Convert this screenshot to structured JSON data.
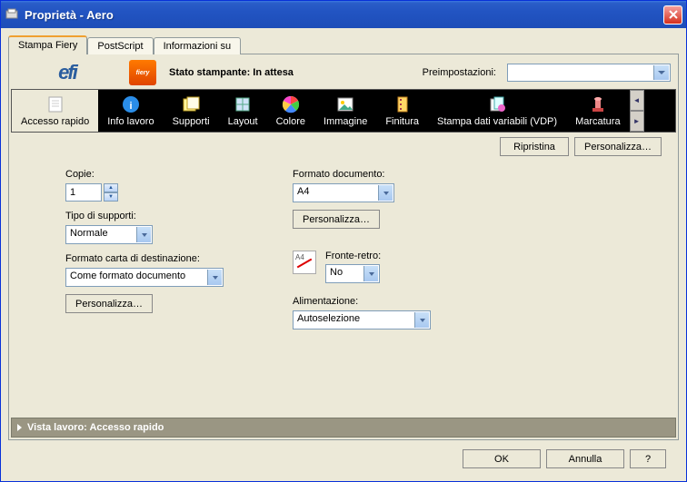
{
  "title": "Proprietà - Aero",
  "tabs": {
    "t0": "Stampa Fiery",
    "t1": "PostScript",
    "t2": "Informazioni su"
  },
  "header": {
    "status_prefix": "Stato stampante: ",
    "status_value": "In attesa",
    "presets_label": "Preimpostazioni:"
  },
  "toolbar": {
    "access": "Accesso rapido",
    "info": "Info lavoro",
    "media": "Supporti",
    "layout": "Layout",
    "color": "Colore",
    "image": "Immagine",
    "finish": "Finitura",
    "vdp": "Stampa dati variabili (VDP)",
    "mark": "Marcatura"
  },
  "actions": {
    "reset": "Ripristina",
    "customize": "Personalizza…"
  },
  "form": {
    "copies_label": "Copie:",
    "copies_value": "1",
    "media_label": "Tipo di supporti:",
    "media_value": "Normale",
    "dest_label": "Formato carta di destinazione:",
    "dest_value": "Come formato documento",
    "dest_customize": "Personalizza…",
    "docfmt_label": "Formato documento:",
    "docfmt_value": "A4",
    "docfmt_customize": "Personalizza…",
    "duplex_label": "Fronte-retro:",
    "duplex_value": "No",
    "feed_label": "Alimentazione:",
    "feed_value": "Autoselezione"
  },
  "viewbar": "Vista lavoro: Accesso rapido",
  "footer": {
    "ok": "OK",
    "cancel": "Annulla",
    "help": "?"
  }
}
